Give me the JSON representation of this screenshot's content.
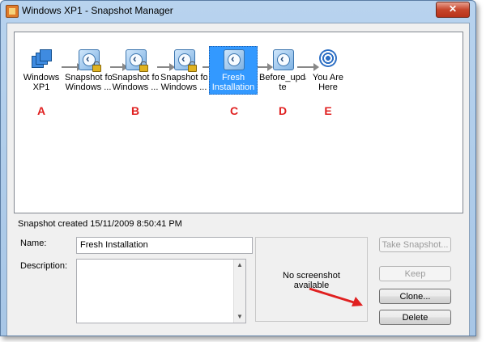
{
  "window": {
    "title": "Windows XP1 - Snapshot Manager",
    "close_label": "✕"
  },
  "tree": {
    "nodes": [
      {
        "label": "Windows\nXP1",
        "letter": "A"
      },
      {
        "label": "Snapshot for\nWindows ...",
        "letter": ""
      },
      {
        "label": "Snapshot for\nWindows ...",
        "letter": "B"
      },
      {
        "label": "Snapshot for\nWindows ...",
        "letter": ""
      },
      {
        "label": "Fresh\nInstallation",
        "letter": "C"
      },
      {
        "label": "Before_upda\nte",
        "letter": "D"
      },
      {
        "label": "You Are\nHere",
        "letter": "E"
      }
    ],
    "letters": [
      "A",
      "B",
      "C",
      "D",
      "E"
    ]
  },
  "details": {
    "created": "Snapshot created 15/11/2009 8:50:41 PM",
    "name_label": "Name:",
    "name_value": "Fresh Installation",
    "description_label": "Description:",
    "description_value": "",
    "preview_text": "No screenshot\navailable"
  },
  "buttons": {
    "take_snapshot": "Take Snapshot...",
    "keep": "Keep",
    "clone": "Clone...",
    "delete": "Delete"
  },
  "colors": {
    "selection": "#3399ff",
    "annotation": "#e02020"
  }
}
